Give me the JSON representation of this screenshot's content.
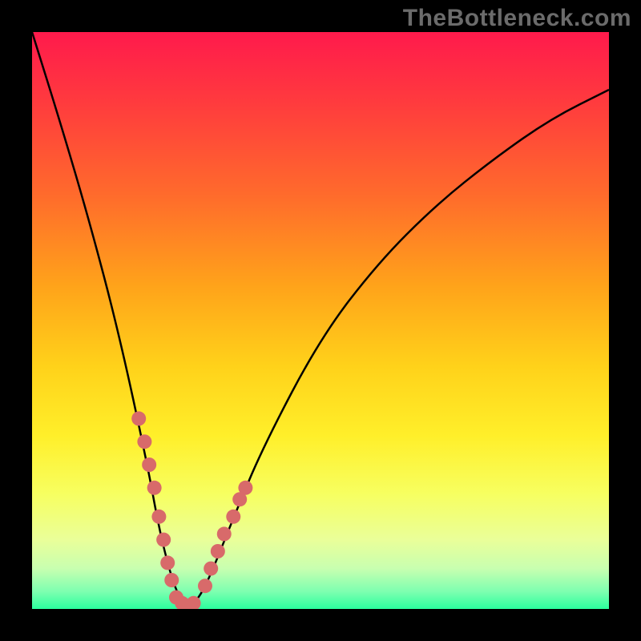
{
  "watermark": "TheBottleneck.com",
  "chart_data": {
    "type": "line",
    "title": "",
    "xlabel": "",
    "ylabel": "",
    "xlim": [
      0,
      100
    ],
    "ylim": [
      0,
      100
    ],
    "series": [
      {
        "name": "curve",
        "x": [
          0,
          5,
          10,
          15,
          20,
          22,
          24,
          25.5,
          27,
          29,
          31,
          35,
          40,
          50,
          60,
          70,
          80,
          90,
          100
        ],
        "y": [
          100,
          84,
          67,
          48,
          25,
          14,
          6,
          2,
          0,
          2,
          6,
          16,
          28,
          47,
          60,
          70,
          78,
          85,
          90
        ]
      }
    ],
    "markers": {
      "name": "dots",
      "color": "#d86a6a",
      "x": [
        18.5,
        19.5,
        20.3,
        21.2,
        22.0,
        22.8,
        23.5,
        24.2,
        25.0,
        26.0,
        27.0,
        28.0,
        30.0,
        31.0,
        32.2,
        33.3,
        34.9,
        36.0,
        37.0
      ],
      "y": [
        33,
        29,
        25,
        21,
        16,
        12,
        8,
        5,
        2,
        1,
        0,
        1,
        4,
        7,
        10,
        13,
        16,
        19,
        21
      ]
    }
  }
}
